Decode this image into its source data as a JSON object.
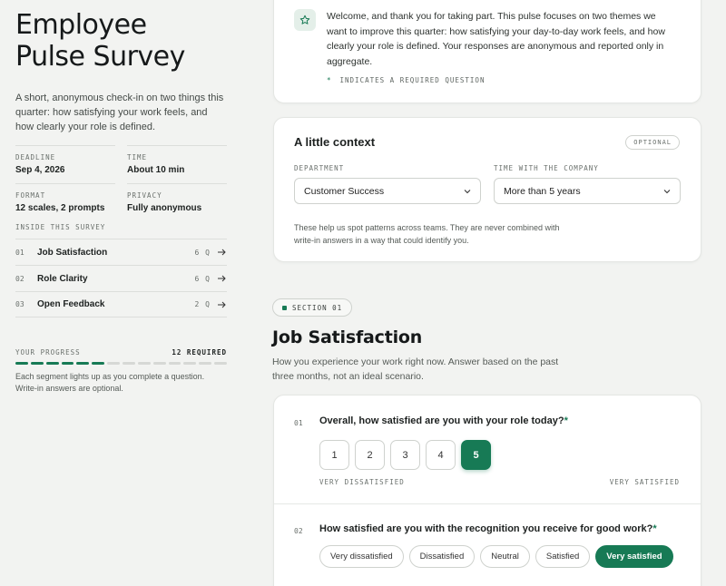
{
  "sidebar": {
    "title_line1": "Employee",
    "title_line2": "Pulse Survey",
    "intro": "A short, anonymous check-in on two things this quarter: how satisfying your work feels, and how clearly your role is defined.",
    "meta": {
      "deadline_label": "DEADLINE",
      "deadline_value": "Sep 4, 2026",
      "time_label": "TIME",
      "time_value": "About 10 min",
      "format_label": "FORMAT",
      "format_value": "12 scales, 2 prompts",
      "privacy_label": "PRIVACY",
      "privacy_value": "Fully anonymous"
    },
    "inside_label": "INSIDE THIS SURVEY",
    "toc": [
      {
        "num": "01",
        "name": "Job Satisfaction",
        "count": "6 Q"
      },
      {
        "num": "02",
        "name": "Role Clarity",
        "count": "6 Q"
      },
      {
        "num": "03",
        "name": "Open Feedback",
        "count": "2 Q"
      }
    ],
    "progress": {
      "label": "YOUR PROGRESS",
      "required": "12 REQUIRED",
      "completed_segments": 6,
      "total_segments": 14,
      "note": "Each segment lights up as you complete a question. Write-in answers are optional."
    }
  },
  "welcome": {
    "icon": "star-icon",
    "text": "Welcome, and thank you for taking part. This pulse focuses on two themes we want to improve this quarter: how satisfying your day-to-day work feels, and how clearly your role is defined. Your responses are anonymous and reported only in aggregate.",
    "required_marker": "*",
    "required_note": "INDICATES A REQUIRED QUESTION"
  },
  "context": {
    "title": "A little context",
    "badge": "OPTIONAL",
    "department_label": "DEPARTMENT",
    "department_value": "Customer Success",
    "tenure_label": "TIME WITH THE COMPANY",
    "tenure_value": "More than 5 years",
    "note": "These help us spot patterns across teams. They are never combined with write-in answers in a way that could identify you."
  },
  "section": {
    "pill": "SECTION 01",
    "title": "Job Satisfaction",
    "description": "How you experience your work right now. Answer based on the past three months, not an ideal scenario."
  },
  "questions": {
    "q1": {
      "num": "01",
      "text": "Overall, how satisfied are you with your role today?",
      "required": "*",
      "options": [
        "1",
        "2",
        "3",
        "4",
        "5"
      ],
      "selected_index": 4,
      "low_label": "VERY DISSATISFIED",
      "high_label": "VERY SATISFIED"
    },
    "q2": {
      "num": "02",
      "text": "How satisfied are you with the recognition you receive for good work?",
      "required": "*",
      "options": [
        "Very dissatisfied",
        "Dissatisfied",
        "Neutral",
        "Satisfied",
        "Very satisfied"
      ],
      "selected_index": 4
    }
  },
  "colors": {
    "accent": "#177a55",
    "background": "#f2f3f1",
    "card": "#ffffff"
  }
}
